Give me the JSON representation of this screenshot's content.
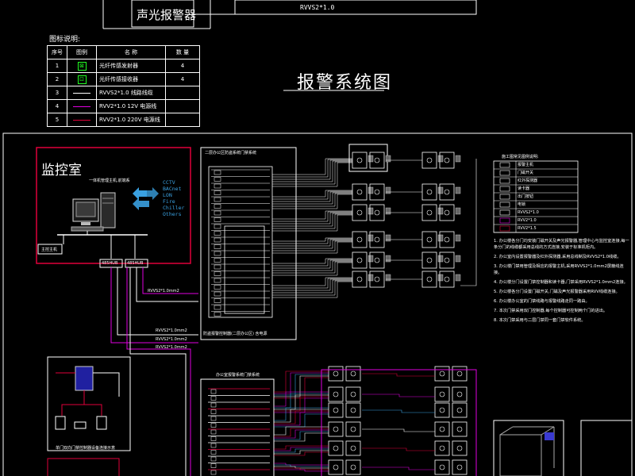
{
  "top": {
    "alarm_device_label": "声光报警器",
    "cable_label": "RVVS2*1.0"
  },
  "legend": {
    "title": "图标说明:",
    "headers": [
      "序号",
      "图例",
      "名 称",
      "数 量"
    ],
    "rows": [
      {
        "no": "1",
        "name": "光纤传感发射器",
        "qty": "4"
      },
      {
        "no": "2",
        "name": "光纤传感接收器",
        "qty": "4"
      },
      {
        "no": "3",
        "name": "RVVS2*1.0 线路线缆",
        "qty": ""
      },
      {
        "no": "4",
        "name": "RVV2*1.0 12V 电源线",
        "qty": ""
      },
      {
        "no": "5",
        "name": "RVV2*1.0 220V 电源线",
        "qty": ""
      }
    ]
  },
  "diagram_title": "报警系统图",
  "monitor_room": {
    "title": "监控室",
    "pc_label": "一体机管理主机,前端系",
    "systems": [
      "CCTV",
      "BACnet",
      "LON",
      "Fire",
      "Chiller",
      "Others"
    ],
    "host_label": "主控主机",
    "bus1": "485HUB",
    "bus2": "485HUB",
    "cable1": "RVVS2*1.0mm2",
    "cable2": "RVVS2*1.0mm2",
    "cable3": "RVVS2*1.0mm2",
    "cable4": "RVVS2*1.0mm2"
  },
  "panel_top": {
    "title": "二层办公区防盗系统门禁系统",
    "footer": "防盗报警控制器(二层办公区) 含电源"
  },
  "panel_bottom": {
    "title": "办公室报警系统门禁系统"
  },
  "inset": {
    "caption": "单门双向门禁控制器设备连接示意"
  },
  "right_legend": {
    "title": "施工图常见图例说明:",
    "items": [
      "报警主机",
      "门磁开关",
      "红外探测器",
      "读卡器",
      "出门按钮",
      "电锁",
      "RVVS2*1.0",
      "RVV2*1.0",
      "RVV2*1.5"
    ]
  },
  "notes": [
    "1. 办公楼各分门均安装门磁开关及声光报警器,管理中心与监控室连接,每一条分门的线缆都采用总线的方式连接,安装于标准机柜内。",
    "2. 办公室内设置报警器及红外探测器,采用总线制及RVVS2*1.0线缆。",
    "3. 办公楼门禁用管理及相应的报警主机,采用RVVS2*1.0mm2屏蔽线连接。",
    "4. 办公楼分门设置门禁控制器和读卡器,门禁采用RVVS2*1.0mm2连接。",
    "5. 办公楼各分门设置门磁开关,门磁及声光报警器采用RVV线缆连接。",
    "6. 办公楼办公室的门禁线路与报警线路走同一路由。",
    "7. 本次门禁采用双门控制器,每个控制器可控制两个门的进出。",
    "8. 本次门禁采用与二层门禁同一套门禁软件系统。"
  ]
}
